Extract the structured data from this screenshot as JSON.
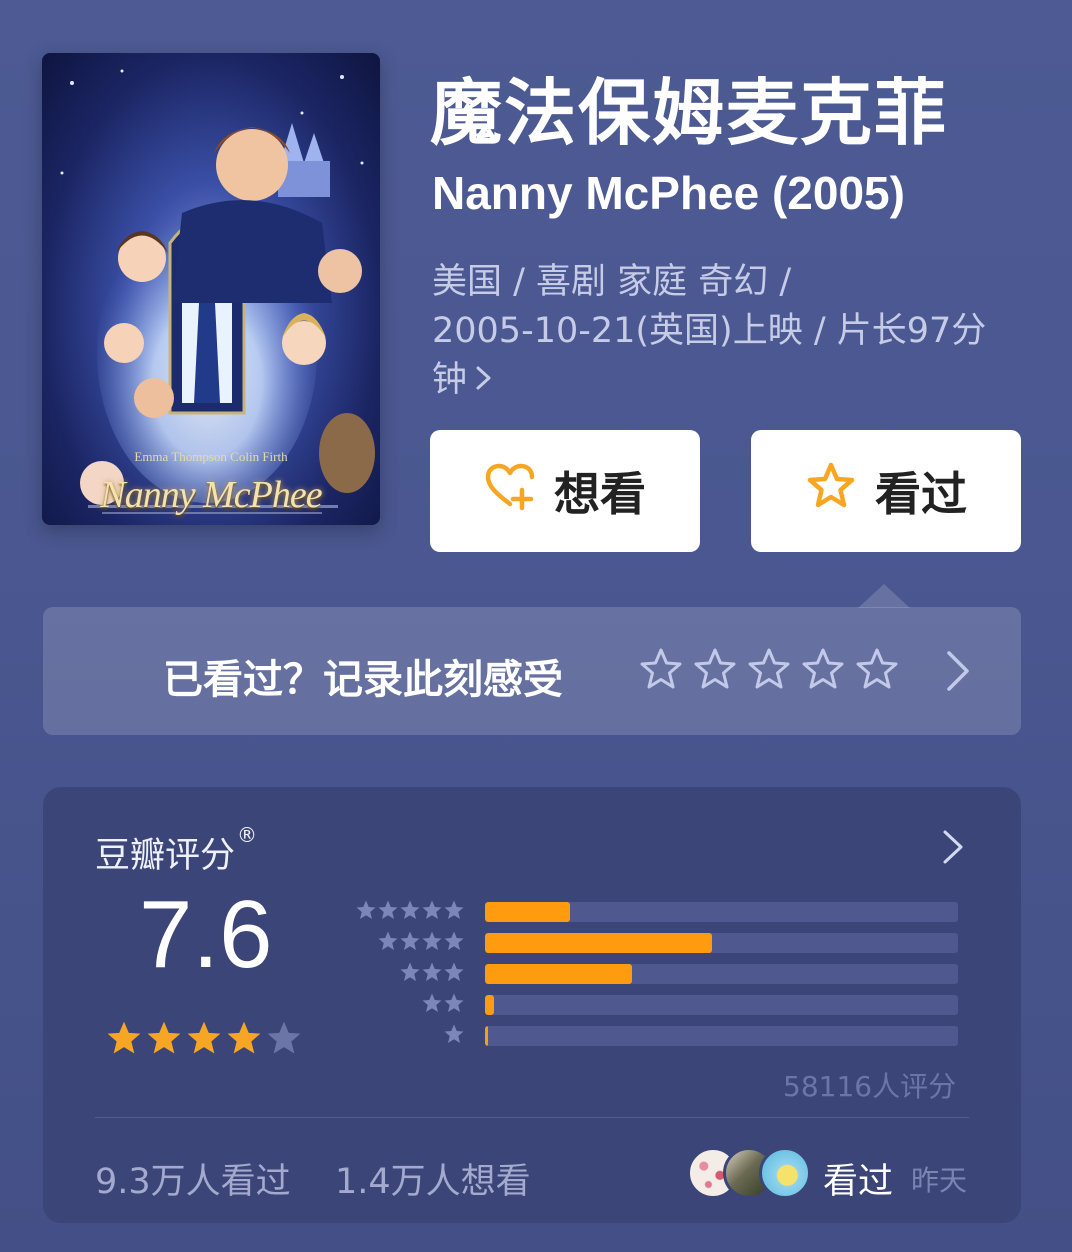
{
  "poster": {
    "cast": "Emma Thompson   Colin Firth",
    "logo": "Nanny McPhee"
  },
  "movie": {
    "title_cn": "魔法保姆麦克菲",
    "title_en": "Nanny McPhee (2005)",
    "meta_line1": "美国 / 喜剧 家庭 奇幻 /",
    "meta_line2": "2005-10-21(英国)上映 / 片长97分",
    "meta_line3": "钟"
  },
  "actions": {
    "want_label": "想看",
    "seen_label": "看过"
  },
  "rate_prompt": {
    "text": "已看过？记录此刻感受",
    "star_count": 5
  },
  "rating": {
    "title": "豆瓣评分",
    "registered_mark": "®",
    "score": "7.6",
    "stars": 4,
    "max_stars": 5,
    "distribution": [
      {
        "stars": 5,
        "fraction": 0.18
      },
      {
        "stars": 4,
        "fraction": 0.48
      },
      {
        "stars": 3,
        "fraction": 0.31
      },
      {
        "stars": 2,
        "fraction": 0.02
      },
      {
        "stars": 1,
        "fraction": 0.005
      }
    ],
    "count_text": "58116人评分",
    "seen_stat": "9.3万人看过",
    "want_stat": "1.4万人想看",
    "friends_label": "看过",
    "friends_time": "昨天"
  },
  "colors": {
    "background": "#4a5790",
    "card": "#3b4578",
    "accent_orange": "#ff9b0f",
    "star_gold": "#f6a623"
  }
}
